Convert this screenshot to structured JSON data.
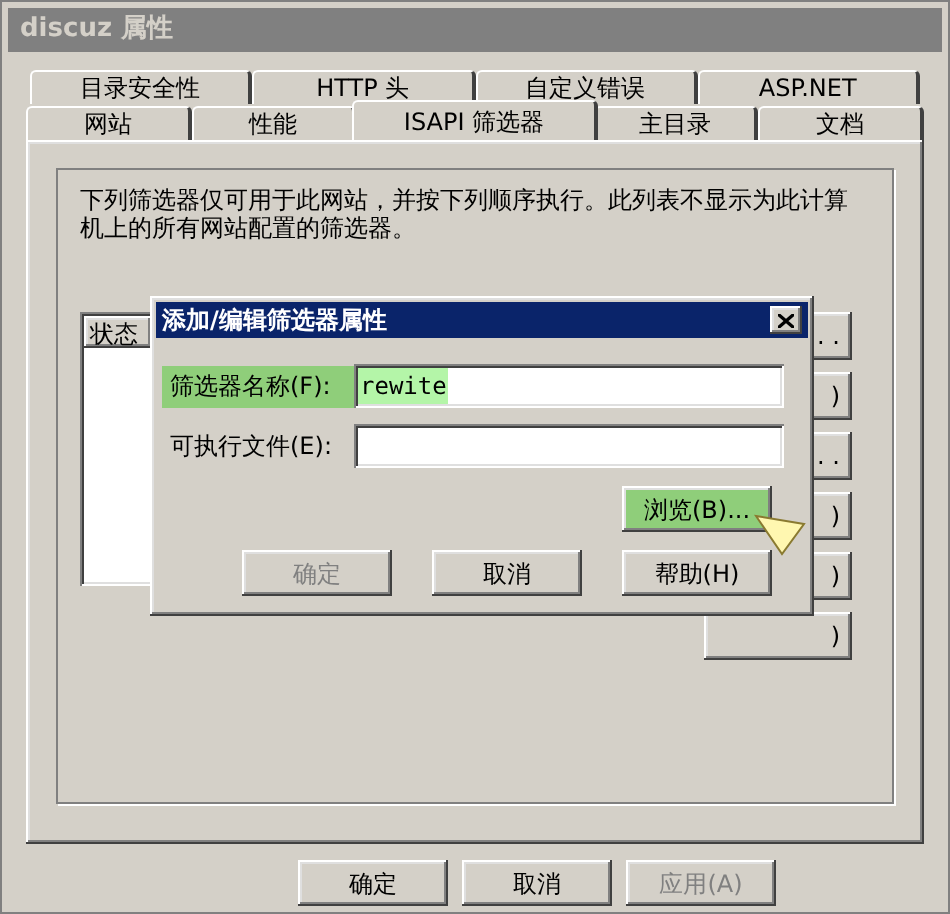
{
  "window": {
    "title": "discuz 属性"
  },
  "tab_rows": [
    [
      {
        "label": "目录安全性",
        "selected": false
      },
      {
        "label": "HTTP 头",
        "selected": false
      },
      {
        "label": "自定义错误",
        "selected": false
      },
      {
        "label": "ASP.NET",
        "selected": false
      }
    ],
    [
      {
        "label": "网站",
        "selected": false
      },
      {
        "label": "性能",
        "selected": false
      },
      {
        "label": "ISAPI 筛选器",
        "selected": true
      },
      {
        "label": "主目录",
        "selected": false
      },
      {
        "label": "文档",
        "selected": false
      }
    ]
  ],
  "description": "下列筛选器仅可用于此网站，并按下列顺序执行。此列表不显示为此计算机上的所有网站配置的筛选器。",
  "filter_list": {
    "columns": [
      "状态"
    ]
  },
  "side_buttons": [
    {
      "label": ". ."
    },
    {
      "label": ")"
    },
    {
      "label": ". ."
    },
    {
      "label": ")"
    },
    {
      "label": ")"
    },
    {
      "label": ")"
    }
  ],
  "dialog": {
    "title": "添加/编辑筛选器属性",
    "fields": [
      {
        "label": "筛选器名称(F):",
        "value": "rewite",
        "highlighted": true
      },
      {
        "label": "可执行文件(E):",
        "highlighted": false
      }
    ],
    "browse_button": {
      "label": "浏览(B)...",
      "highlighted": true
    },
    "buttons": [
      {
        "label": "确定",
        "disabled": true
      },
      {
        "label": "取消",
        "disabled": false
      },
      {
        "label": "帮助(H)",
        "disabled": false
      }
    ]
  },
  "buttons": [
    {
      "label": "确定",
      "disabled": false
    },
    {
      "label": "取消",
      "disabled": false
    },
    {
      "label": "应用(A)",
      "disabled": true
    }
  ]
}
